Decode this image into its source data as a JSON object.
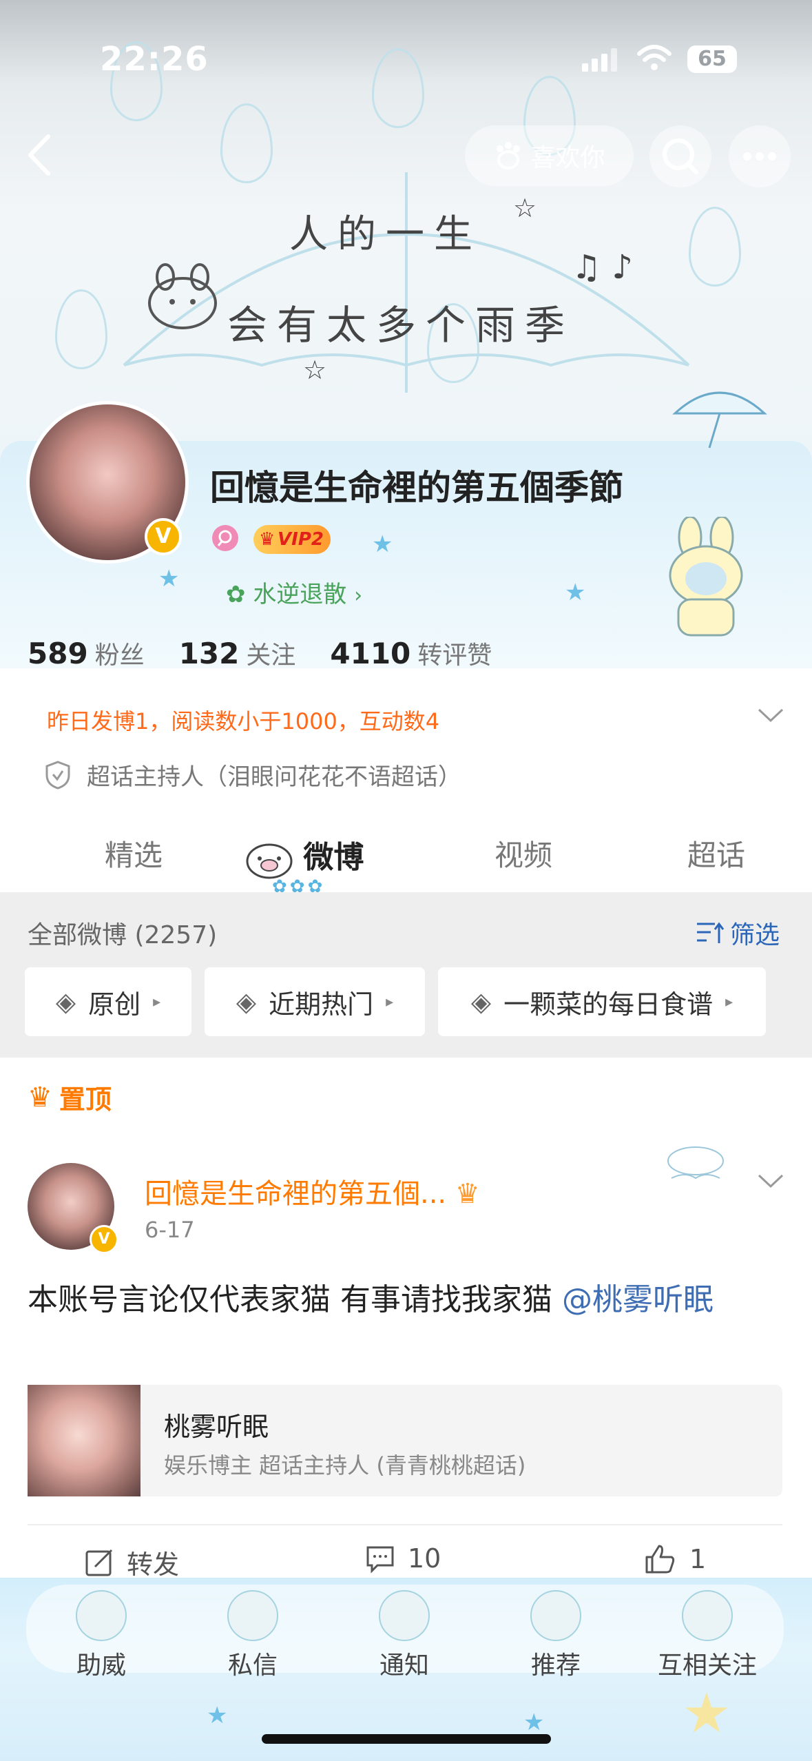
{
  "status_bar": {
    "time": "22:26",
    "battery": "65"
  },
  "header": {
    "like_label": "喜欢你",
    "banner_line1": "人的一生",
    "banner_line2": "会有太多个雨季"
  },
  "profile": {
    "username": "回憶是生命裡的第五個季節",
    "vip_label": "VIP2",
    "group_label": "水逆退散",
    "stats": [
      {
        "value": "589",
        "label": "粉丝"
      },
      {
        "value": "132",
        "label": "关注"
      },
      {
        "value": "4110",
        "label": "转评赞"
      }
    ],
    "activity": "昨日发博1，阅读数小于1000，互动数4",
    "host_role": "超话主持人（泪眼问花花不语超话）"
  },
  "tabs": [
    {
      "label": "精选",
      "active": false
    },
    {
      "label": "微博",
      "active": true
    },
    {
      "label": "视频",
      "active": false
    },
    {
      "label": "超话",
      "active": false
    }
  ],
  "filter": {
    "all_label": "全部微博 (2257)",
    "filter_label": "筛选",
    "chips": [
      "原创",
      "近期热门",
      "一颗菜的每日食谱"
    ]
  },
  "pinned_label": "置顶",
  "post": {
    "author": "回憶是生命裡的第五個...",
    "date": "6-17",
    "text": "本账号言论仅代表家猫 有事请找我家猫",
    "mention": "@桃雾听眠",
    "quote": {
      "name": "桃雾听眠",
      "desc": "娱乐博主 超话主持人 (青青桃桃超话)"
    },
    "actions": {
      "repost": "转发",
      "comments": "10",
      "likes": "1"
    }
  },
  "bottom_nav": [
    "助威",
    "私信",
    "通知",
    "推荐",
    "互相关注"
  ],
  "colors": {
    "accent_orange": "#ff7a00",
    "link_blue": "#3e6db3",
    "group_green": "#4aa35a"
  }
}
